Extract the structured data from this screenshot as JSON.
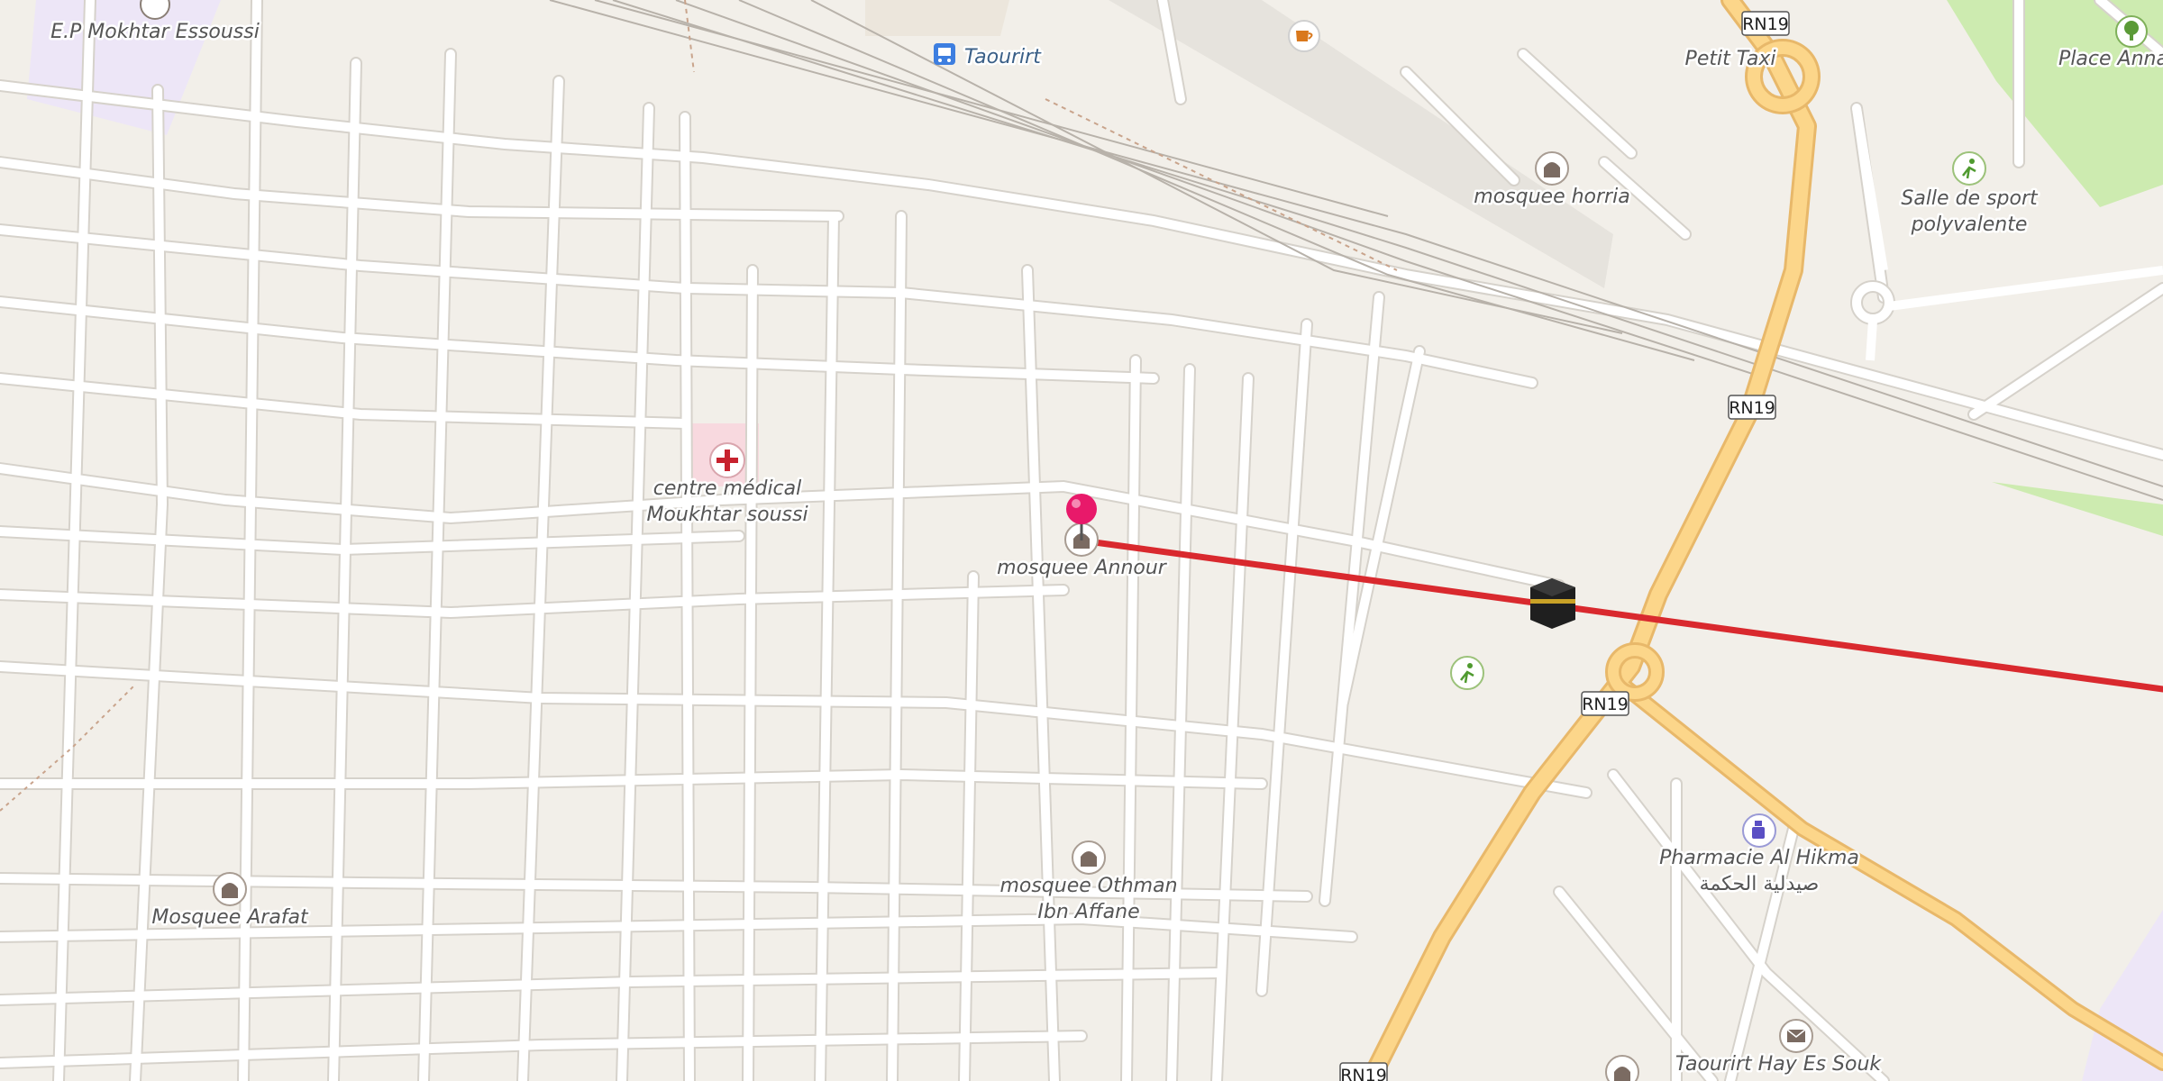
{
  "map": {
    "colors": {
      "background": "#f2efe9",
      "road": "#ffffff",
      "road_casing": "#d6d2cb",
      "primary_road": "#fcd68a",
      "primary_casing": "#e8b86a",
      "rail": "#b8b2aa",
      "park": "#cdebb0",
      "school_area": "#ede6f7",
      "hospital_area": "#f8d9df",
      "route_line": "#d9292e",
      "pin": "#e8196a"
    },
    "road_shields": [
      {
        "ref": "RN19",
        "id": "top"
      },
      {
        "ref": "RN19",
        "id": "mid"
      },
      {
        "ref": "RN19",
        "id": "roundabout"
      },
      {
        "ref": "RN19",
        "id": "bottom"
      }
    ],
    "pois": [
      {
        "id": "school",
        "label": "E.P Mokhtar Essoussi",
        "icon": "school-icon"
      },
      {
        "id": "station",
        "label": "Taourirt",
        "icon": "bus-station-icon"
      },
      {
        "id": "cafe",
        "label": "",
        "icon": "cafe-icon"
      },
      {
        "id": "taxi",
        "label": "Petit Taxi",
        "icon": "taxi-label"
      },
      {
        "id": "park-place",
        "label": "Place Anna",
        "icon": "park-icon"
      },
      {
        "id": "mosque-horria",
        "label": "mosquee horria",
        "icon": "mosque-icon"
      },
      {
        "id": "sport-hall",
        "label_lines": [
          "Salle de sport",
          "polyvalente"
        ],
        "icon": "sport-icon"
      },
      {
        "id": "clinic",
        "label_lines": [
          "centre médical",
          "Moukhtar soussi"
        ],
        "icon": "medical-cross-icon"
      },
      {
        "id": "mosque-annour",
        "label": "mosquee Annour",
        "icon": "mosque-icon"
      },
      {
        "id": "sport-field",
        "label": "",
        "icon": "sport-icon"
      },
      {
        "id": "kaaba",
        "label": "",
        "icon": "kaaba-icon"
      },
      {
        "id": "pharmacy",
        "label_lines": [
          "Pharmacie Al Hikma",
          "صيدلية الحكمة"
        ],
        "icon": "pharmacy-icon"
      },
      {
        "id": "mosque-arafat",
        "label": "Mosquee Arafat",
        "icon": "mosque-icon"
      },
      {
        "id": "mosque-othman",
        "label_lines": [
          "mosquee Othman",
          "Ibn Affane"
        ],
        "icon": "mosque-icon"
      },
      {
        "id": "post",
        "label": "Taourirt Hay Es Souk",
        "icon": "post-office-icon"
      }
    ],
    "qibla_line": {
      "from": "mosquee Annour",
      "direction": "east-southeast"
    }
  }
}
